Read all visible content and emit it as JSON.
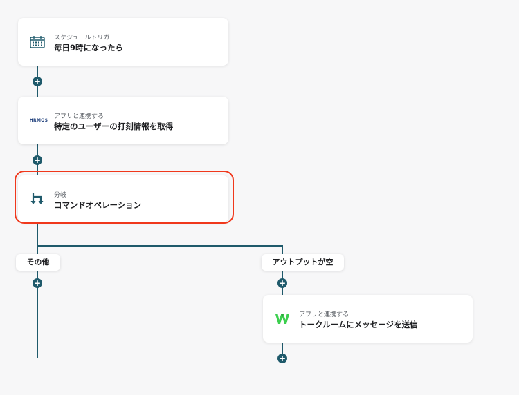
{
  "nodes": [
    {
      "subtitle": "スケジュールトリガー",
      "title": "毎日9時になったら",
      "icon": "calendar-icon"
    },
    {
      "subtitle": "アプリと連携する",
      "title": "特定のユーザーの打刻情報を取得",
      "icon": "hrmos-logo",
      "logo_text": "HRMOS"
    },
    {
      "subtitle": "分岐",
      "title": "コマンドオペレーション",
      "icon": "branch-icon",
      "selected": true
    },
    {
      "subtitle": "アプリと連携する",
      "title": "トークルームにメッセージを送信",
      "icon": "w-logo-icon"
    }
  ],
  "branches": [
    {
      "label": "その他"
    },
    {
      "label": "アウトプットが空"
    }
  ],
  "colors": {
    "accent": "#1f5a6b",
    "selected_border": "#f0381c",
    "background": "#f7f7f8"
  }
}
